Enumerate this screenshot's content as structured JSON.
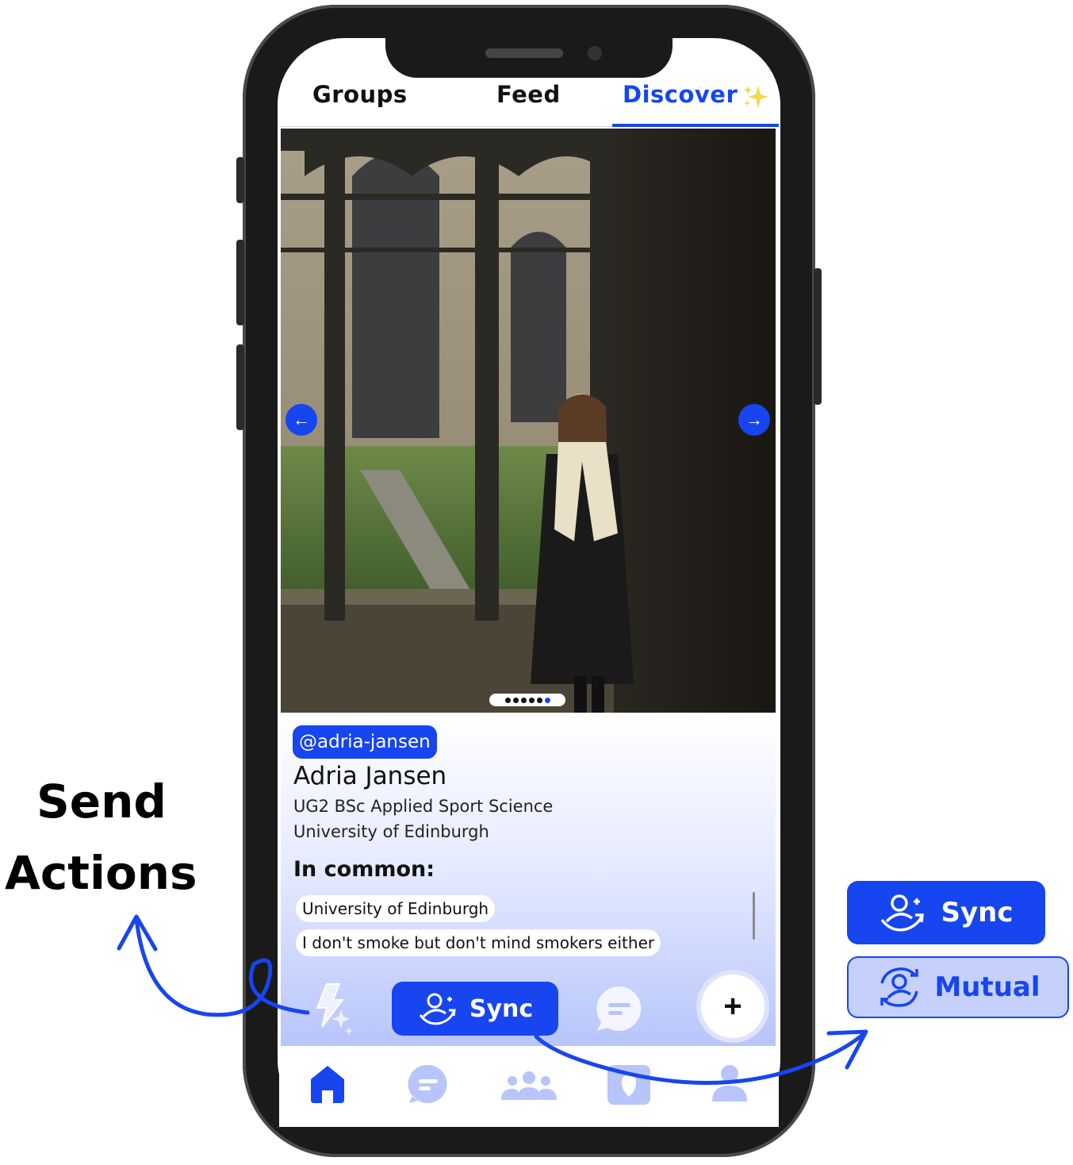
{
  "tabs": {
    "groups": "Groups",
    "feed": "Feed",
    "discover": "Discover",
    "discover_icon": "sparkles-icon"
  },
  "photo": {
    "carousel_pages": 6,
    "active_page": 6
  },
  "profile": {
    "handle": "@adria-jansen",
    "name": "Adria Jansen",
    "course": "UG2 BSc Applied Sport Science",
    "university": "University of Edinburgh",
    "in_common_title": "In common:",
    "in_common": [
      "University of Edinburgh",
      "I don't smoke but don't mind smokers either"
    ]
  },
  "actions": {
    "sync_label": "Sync",
    "spark_icon": "lightning-sparkle-icon",
    "chat_icon": "chat-bubble-icon",
    "plus_label": "+"
  },
  "bottom_nav": [
    "home-icon",
    "chat-icon",
    "groups-icon",
    "badge-icon",
    "profile-icon"
  ],
  "annotations": {
    "send_line1": "Send",
    "send_line2": "Actions",
    "sync_label": "Sync",
    "mutual_label": "Mutual"
  },
  "colors": {
    "accent": "#1745f0",
    "light_accent": "#c5d0fb"
  }
}
